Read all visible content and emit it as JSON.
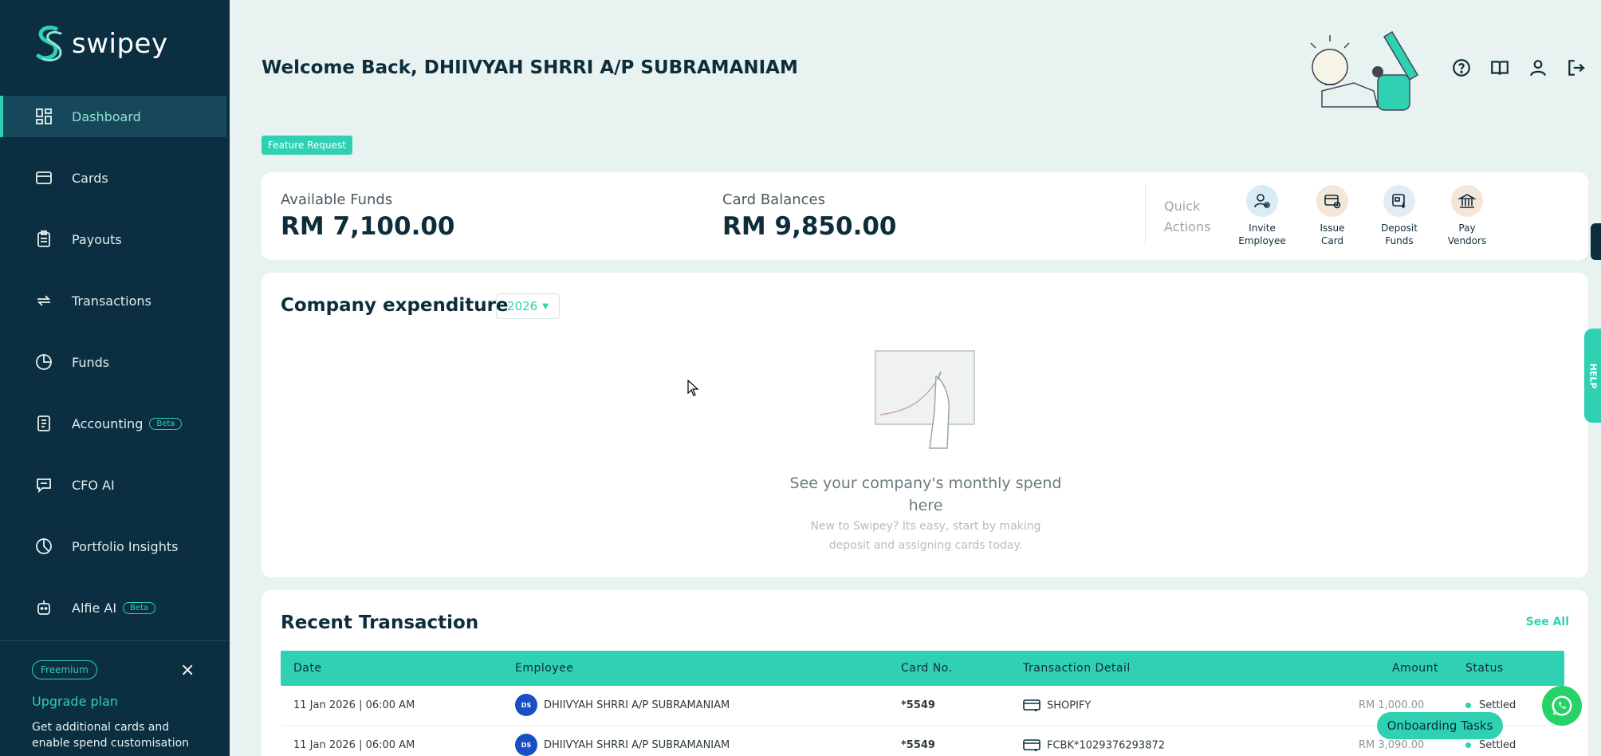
{
  "brand": {
    "name": "swipey",
    "accent": "#2fd1b2",
    "sidebar_bg": "#0b2e40"
  },
  "sidebar": {
    "items": [
      {
        "label": "Dashboard",
        "icon": "dashboard-icon",
        "active": true
      },
      {
        "label": "Cards",
        "icon": "card-icon"
      },
      {
        "label": "Payouts",
        "icon": "clipboard-icon"
      },
      {
        "label": "Transactions",
        "icon": "exchange-icon"
      },
      {
        "label": "Funds",
        "icon": "pie-icon"
      },
      {
        "label": "Accounting",
        "icon": "ledger-icon",
        "badge": "Beta"
      },
      {
        "label": "CFO AI",
        "icon": "chat-icon"
      },
      {
        "label": "Portfolio Insights",
        "icon": "pie-icon"
      },
      {
        "label": "Alfie AI",
        "icon": "robot-icon",
        "badge": "Beta"
      }
    ],
    "plan_badge": "Freemium",
    "close": "×",
    "upgrade_title": "Upgrade plan",
    "upgrade_desc": "Get additional cards and enable spend customisation"
  },
  "header": {
    "welcome": "Welcome Back, DHIIVYAH SHRRI A/P SUBRAMANIAM",
    "feature_request": "Feature Request",
    "icons": [
      "help-icon",
      "book-icon",
      "user-icon",
      "logout-icon"
    ]
  },
  "funds": {
    "available_label": "Available Funds",
    "available_value": "RM 7,100.00",
    "balances_label": "Card Balances",
    "balances_value": "RM 9,850.00",
    "quick_actions_label_1": "Quick",
    "quick_actions_label_2": "Actions",
    "actions": [
      {
        "line1": "Invite",
        "line2": "Employee",
        "icon": "invite-employee-icon",
        "bg": "#d9ebf4"
      },
      {
        "line1": "Issue",
        "line2": "Card",
        "icon": "issue-card-icon",
        "bg": "#f4e6d8"
      },
      {
        "line1": "Deposit",
        "line2": "Funds",
        "icon": "deposit-funds-icon",
        "bg": "#e3ebf3"
      },
      {
        "line1": "Pay",
        "line2": "Vendors",
        "icon": "pay-vendors-icon",
        "bg": "#f4e6d8"
      }
    ]
  },
  "expenditure": {
    "title": "Company expenditure",
    "year": "2026",
    "empty_title": "See your company's monthly spend here",
    "empty_sub": "New to Swipey? Its easy, start by making deposit and assigning cards today."
  },
  "transactions": {
    "title": "Recent Transaction",
    "see_all": "See All",
    "columns": {
      "date": "Date",
      "employee": "Employee",
      "card": "Card No.",
      "detail": "Transaction Detail",
      "amount": "Amount",
      "status": "Status"
    },
    "rows": [
      {
        "date": "11 Jan 2026 | 06:00 AM",
        "initials": "DS",
        "employee": "DHIIVYAH SHRRI A/P SUBRAMANIAM",
        "card": "*5549",
        "detail": "SHOPIFY",
        "amount": "RM 1,000.00",
        "status": "Settled"
      },
      {
        "date": "11 Jan 2026 | 06:00 AM",
        "initials": "DS",
        "employee": "DHIIVYAH SHRRI A/P SUBRAMANIAM",
        "card": "*5549",
        "detail": "FCBK*1029376293872",
        "amount": "RM 3,090.00",
        "status": "Settled"
      }
    ]
  },
  "floating": {
    "onboarding": "Onboarding Tasks",
    "help": "HELP"
  }
}
